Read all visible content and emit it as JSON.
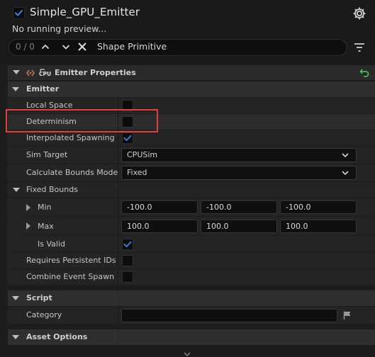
{
  "header": {
    "emitter_name": "Simple_GPU_Emitter",
    "status": "No running preview...",
    "enabled": true
  },
  "search": {
    "count": "0 / 0",
    "query": "Shape Primitive"
  },
  "section": {
    "title": "Emitter Properties",
    "cpu_badge": "CPU"
  },
  "categories": {
    "emitter": "Emitter",
    "script": "Script",
    "asset_options": "Asset Options"
  },
  "properties": {
    "local_space": {
      "label": "Local Space",
      "checked": false
    },
    "determinism": {
      "label": "Determinism",
      "checked": false
    },
    "interpolated_spawning": {
      "label": "Interpolated Spawning",
      "checked": true
    },
    "sim_target": {
      "label": "Sim Target",
      "value": "CPUSim"
    },
    "calc_bounds_mode": {
      "label": "Calculate Bounds Mode",
      "value": "Fixed"
    },
    "fixed_bounds": {
      "label": "Fixed Bounds"
    },
    "min": {
      "label": "Min",
      "x": "-100.0",
      "y": "-100.0",
      "z": "-100.0"
    },
    "max": {
      "label": "Max",
      "x": "100.0",
      "y": "100.0",
      "z": "100.0"
    },
    "is_valid": {
      "label": "Is Valid",
      "checked": true
    },
    "requires_persistent_ids": {
      "label": "Requires Persistent IDs",
      "checked": false
    },
    "combine_event_spawn": {
      "label": "Combine Event Spawn",
      "checked": false
    },
    "category": {
      "label": "Category",
      "value": ""
    }
  },
  "colors": {
    "accent_bar": "#84684e",
    "check_blue": "#2f7cdc",
    "reset_green": "#3fbf5a",
    "highlight_red": "#e0403c"
  }
}
